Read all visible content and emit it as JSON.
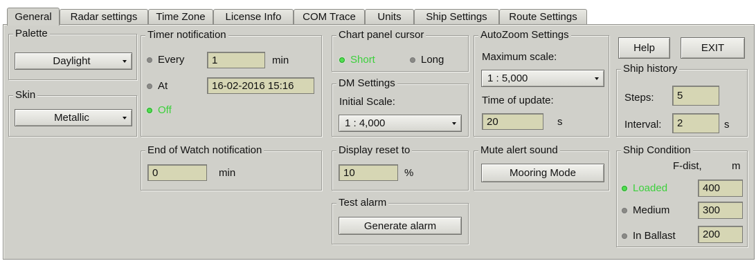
{
  "tabs": [
    "General",
    "Radar settings",
    "Time Zone",
    "License Info",
    "COM Trace",
    "Units",
    "Ship Settings",
    "Route Settings"
  ],
  "palette": {
    "title": "Palette",
    "value": "Daylight"
  },
  "skin": {
    "title": "Skin",
    "value": "Metallic"
  },
  "timer": {
    "title": "Timer notification",
    "every_label": "Every",
    "every_value": "1",
    "every_unit": "min",
    "at_label": "At",
    "at_value": "16-02-2016 15:16",
    "off_label": "Off"
  },
  "end_watch": {
    "title": "End of Watch notification",
    "value": "0",
    "unit": "min"
  },
  "chart_cursor": {
    "title": "Chart panel cursor",
    "short_label": "Short",
    "long_label": "Long"
  },
  "dm_settings": {
    "title": "DM Settings",
    "initial_scale_label": "Initial Scale:",
    "initial_scale_value": "1 : 4,000"
  },
  "display_reset": {
    "title": "Display reset to",
    "value": "10",
    "unit": "%"
  },
  "test_alarm": {
    "title": "Test alarm",
    "button": "Generate alarm"
  },
  "autozoom": {
    "title": "AutoZoom Settings",
    "max_scale_label": "Maximum scale:",
    "max_scale_value": "1 : 5,000",
    "update_label": "Time of update:",
    "update_value": "20",
    "update_unit": "s"
  },
  "mute": {
    "title": "Mute alert sound",
    "button": "Mooring Mode"
  },
  "buttons": {
    "help": "Help",
    "exit": "EXIT"
  },
  "ship_history": {
    "title": "Ship history",
    "steps_label": "Steps:",
    "steps_value": "5",
    "interval_label": "Interval:",
    "interval_value": "2",
    "interval_unit": "s"
  },
  "ship_condition": {
    "title": "Ship Condition",
    "header": "F-dist,",
    "header_unit": "m",
    "rows": [
      {
        "label": "Loaded",
        "value": "400"
      },
      {
        "label": "Medium",
        "value": "300"
      },
      {
        "label": "In Ballast",
        "value": "200"
      }
    ]
  }
}
